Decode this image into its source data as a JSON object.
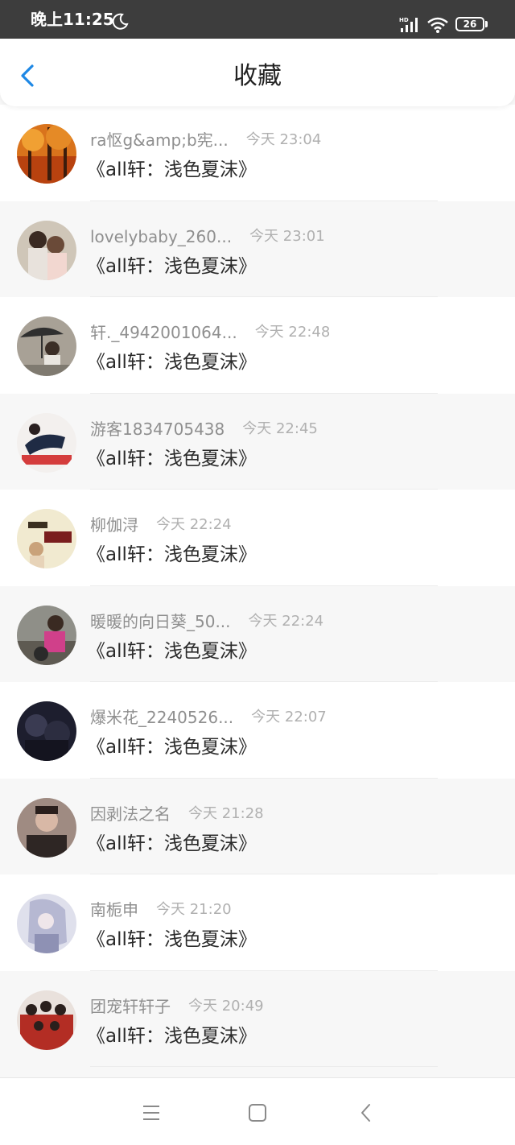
{
  "status_bar": {
    "time": "晚上11:25",
    "battery": "26",
    "icons": [
      "moon-icon",
      "signal-icon",
      "wifi-icon",
      "battery-icon"
    ]
  },
  "header": {
    "title": "收藏",
    "back_icon": "chevron-left-icon"
  },
  "colors": {
    "accent": "#1e88e5",
    "status_bar": "#3d3d3d",
    "name_text": "#8f8f8f",
    "time_text": "#b0b0b0",
    "title_text": "#2b2b2b"
  },
  "items": [
    {
      "user": "ra怄g&amp;b宪...",
      "time": "今天 23:04",
      "book": "《all轩：浅色夏沫》"
    },
    {
      "user": "lovelybaby_260...",
      "time": "今天 23:01",
      "book": "《all轩：浅色夏沫》"
    },
    {
      "user": "轩._4942001064...",
      "time": "今天 22:48",
      "book": "《all轩：浅色夏沫》"
    },
    {
      "user": "游客1834705438",
      "time": "今天 22:45",
      "book": "《all轩：浅色夏沫》"
    },
    {
      "user": "柳伽浔",
      "time": "今天 22:24",
      "book": "《all轩：浅色夏沫》"
    },
    {
      "user": "暖暖的向日葵_50...",
      "time": "今天 22:24",
      "book": "《all轩：浅色夏沫》"
    },
    {
      "user": "爆米花_2240526...",
      "time": "今天 22:07",
      "book": "《all轩：浅色夏沫》"
    },
    {
      "user": "因剥法之名",
      "time": "今天 21:28",
      "book": "《all轩：浅色夏沫》"
    },
    {
      "user": "南栀申",
      "time": "今天 21:20",
      "book": "《all轩：浅色夏沫》"
    },
    {
      "user": "团宠轩轩子",
      "time": "今天 20:49",
      "book": "《all轩：浅色夏沫》"
    }
  ],
  "nav_bar": {
    "icons": [
      "menu-icon",
      "home-square-icon",
      "back-triangle-icon"
    ]
  }
}
